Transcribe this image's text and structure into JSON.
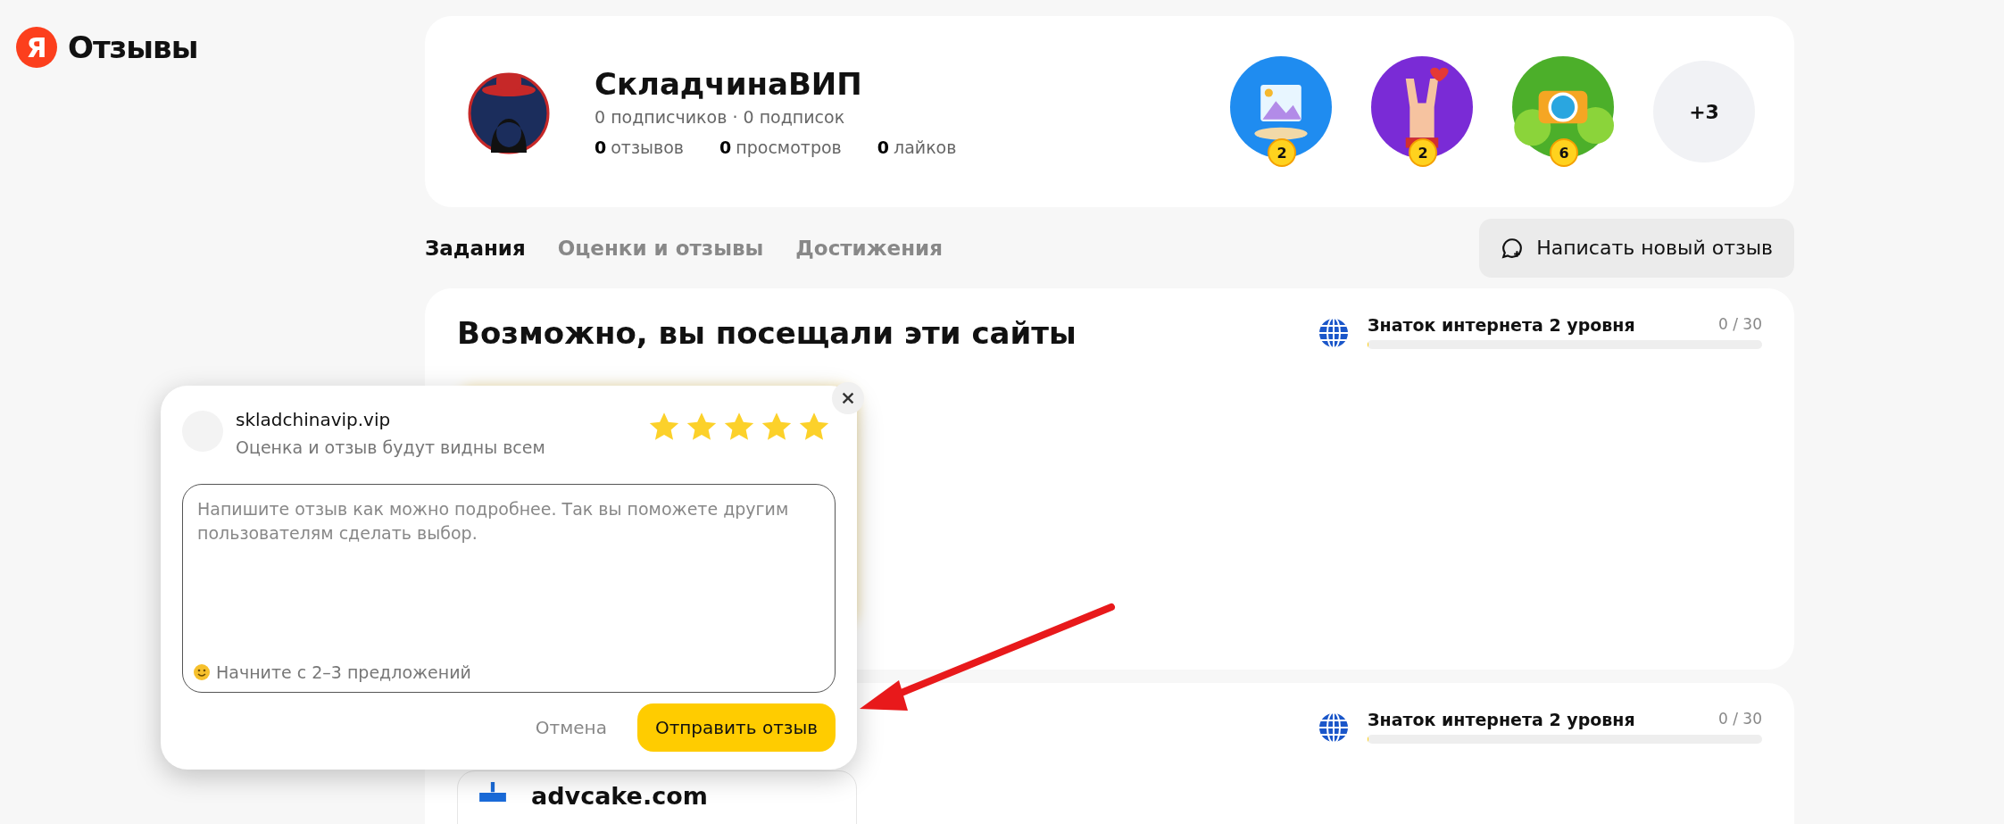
{
  "logo": {
    "letter": "Я",
    "text": "Отзывы"
  },
  "profile": {
    "name": "СкладчинаВИП",
    "follows": "0 подписчиков · 0 подписок",
    "stats": [
      {
        "value": "0",
        "label": "отзывов"
      },
      {
        "value": "0",
        "label": "просмотров"
      },
      {
        "value": "0",
        "label": "лайков"
      }
    ]
  },
  "achievements": [
    {
      "kind": "picture",
      "count": "2"
    },
    {
      "kind": "hand",
      "count": "2"
    },
    {
      "kind": "camera",
      "count": "6"
    }
  ],
  "more_achievements": "+3",
  "tabs": [
    {
      "label": "Задания",
      "selected": true
    },
    {
      "label": "Оценки и отзывы",
      "selected": false
    },
    {
      "label": "Достижения",
      "selected": false
    }
  ],
  "new_review_button": "Написать новый отзыв",
  "cards": [
    {
      "title": "Возможно, вы посещали эти сайты",
      "goal": {
        "label": "Знаток интернета 2 уровня",
        "progress": "0 / 30",
        "level": 0
      }
    },
    {
      "goal": {
        "label": "Знаток интернета 2 уровня",
        "progress": "0 / 30",
        "level": 0
      },
      "sites": [
        {
          "name": "advcake.com"
        }
      ]
    }
  ],
  "dialog": {
    "site": "skladchinavip.vip",
    "subtitle": "Оценка и отзыв будут видны всем",
    "stars": 5,
    "placeholder": "Напишите отзыв как можно подробнее. Так вы поможете другим пользователям сделать выбор.",
    "hint": "Начните с 2–3 предложений",
    "cancel": "Отмена",
    "submit": "Отправить отзыв"
  }
}
